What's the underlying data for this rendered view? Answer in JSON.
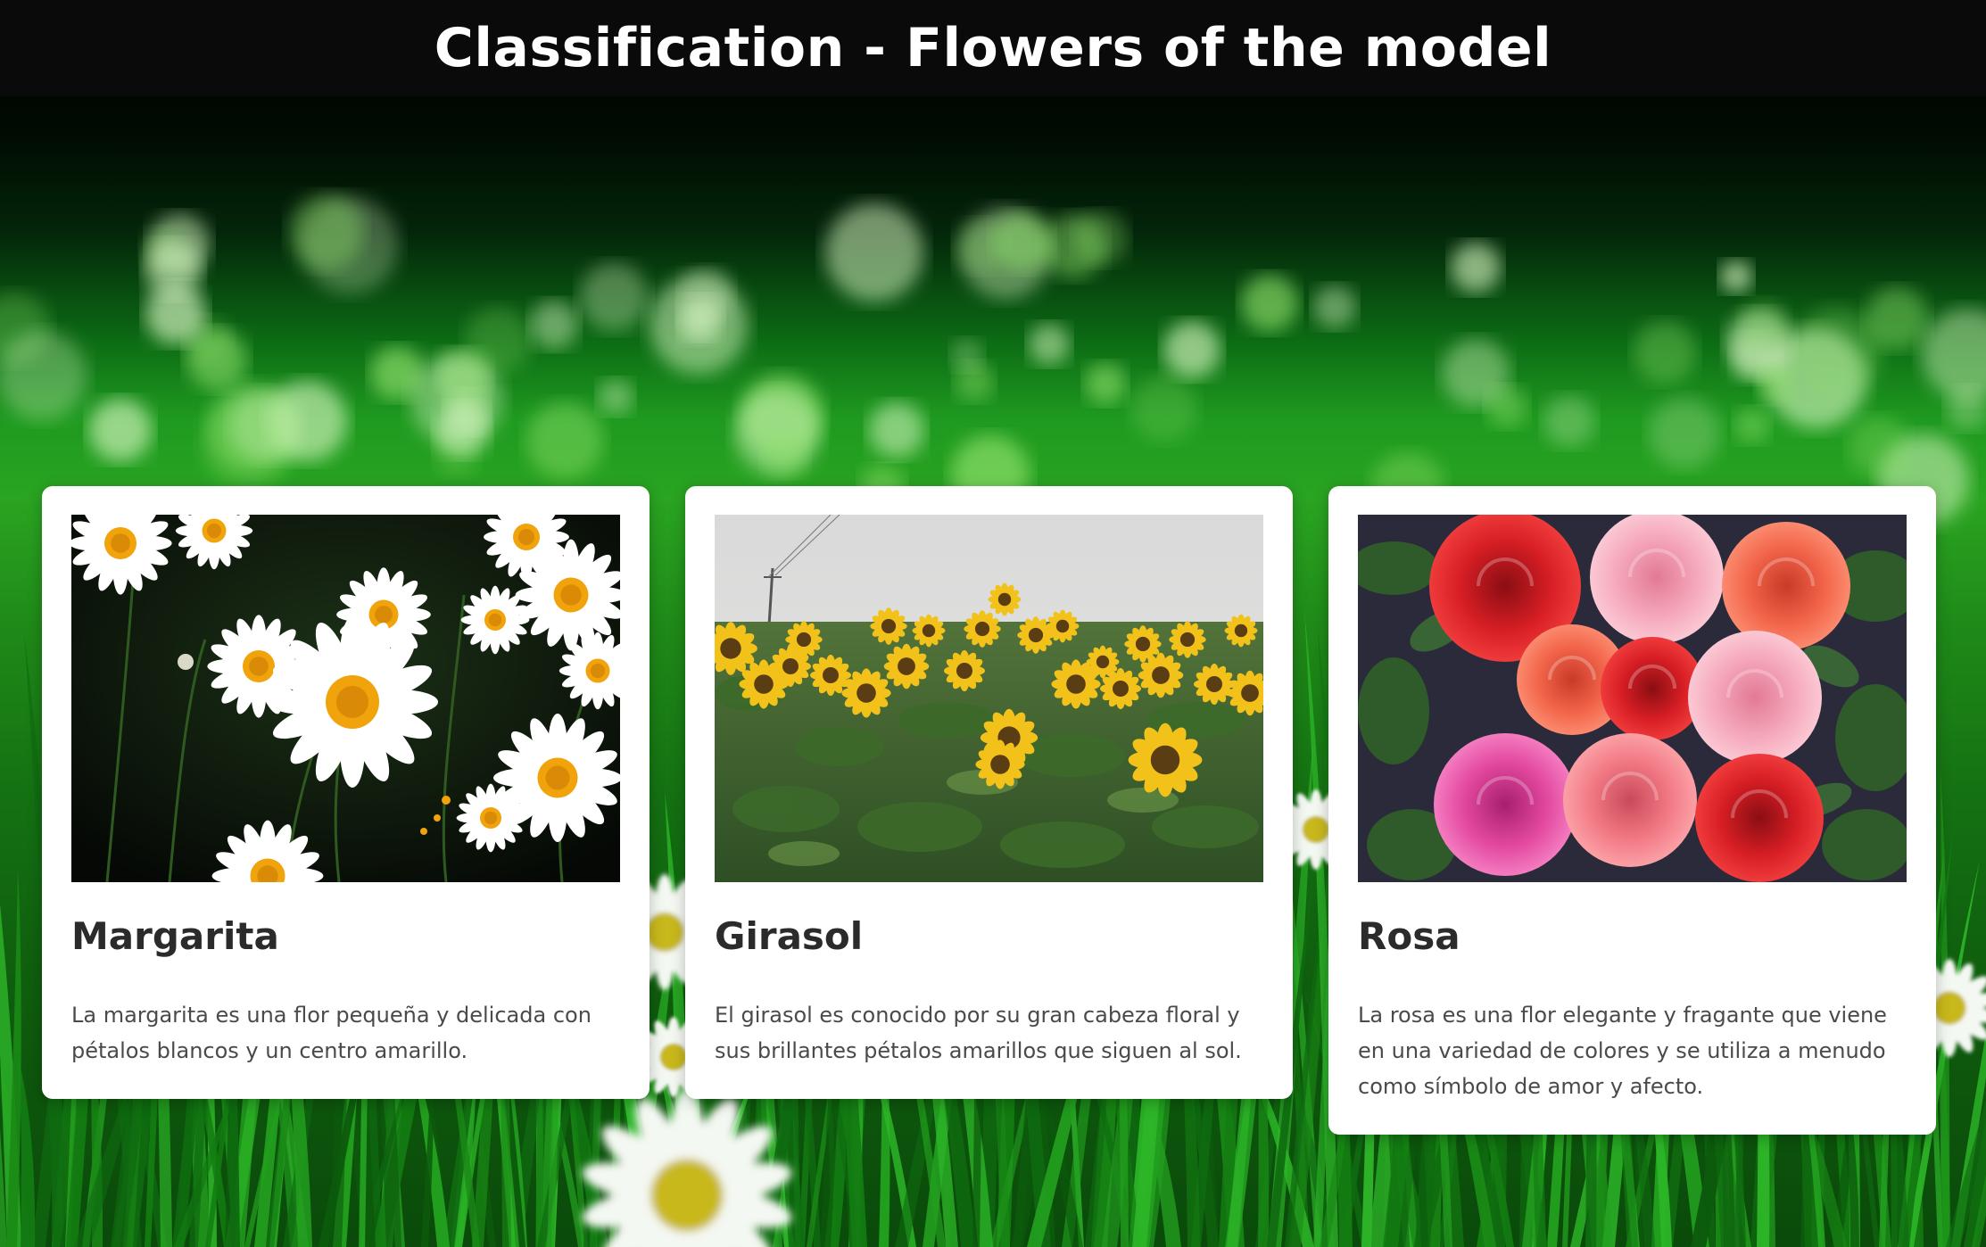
{
  "header": {
    "title": "Classification - Flowers of the model"
  },
  "colors": {
    "header_bg": "#0a0a0a",
    "card_bg": "#ffffff",
    "title_text": "#2b2b2b",
    "body_text": "#4a4a4a",
    "grass_green": "#1f9a20"
  },
  "cards": [
    {
      "title": "Margarita",
      "description": "La margarita es una flor pequeña y delicada con pétalos blancos y un centro amarillo.",
      "image_icon": "daisy-photo"
    },
    {
      "title": "Girasol",
      "description": "El girasol es conocido por su gran cabeza floral y sus brillantes pétalos amarillos que siguen al sol.",
      "image_icon": "sunflower-field-photo"
    },
    {
      "title": "Rosa",
      "description": "La rosa es una flor elegante y fragante que viene en una variedad de colores y se utiliza a menudo como símbolo de amor y afecto.",
      "image_icon": "roses-bouquet-photo"
    }
  ]
}
